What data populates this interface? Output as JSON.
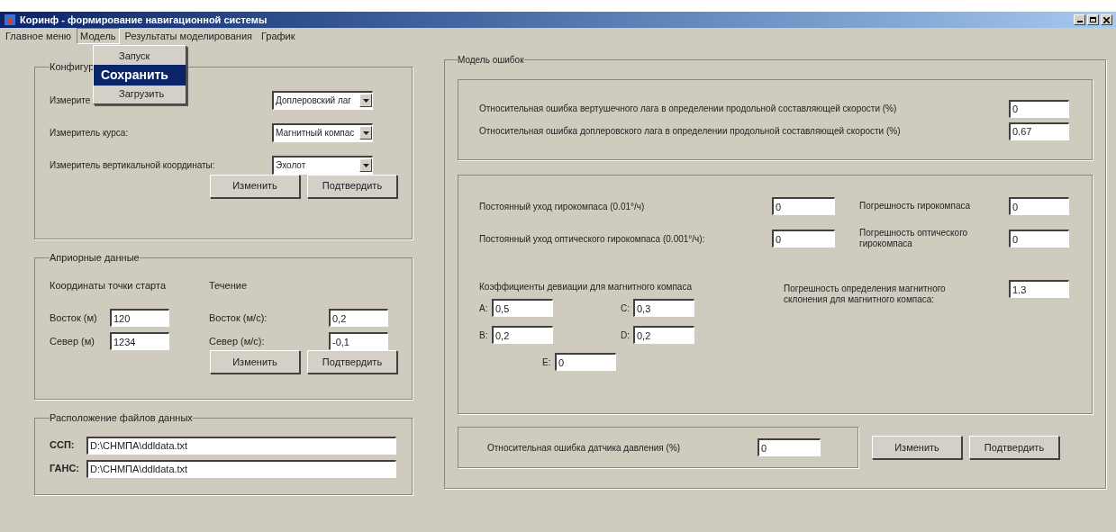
{
  "window": {
    "title": "Коринф - формирование навигационной системы"
  },
  "menu_bar": [
    {
      "label": "Главное меню",
      "selected": false
    },
    {
      "label": "Модель",
      "selected": true
    },
    {
      "label": "Результаты моделирования",
      "selected": false
    },
    {
      "label": "График",
      "selected": false
    }
  ],
  "dropdown_menu": [
    {
      "label": "Запуск",
      "selected": false
    },
    {
      "label": "Сохранить",
      "selected": true
    },
    {
      "label": "Загрузить",
      "selected": false
    }
  ],
  "configuration": {
    "title": "Конфигур",
    "rows": [
      {
        "label": "Измерите",
        "value": "Доплеровский лаг"
      },
      {
        "label": "Измеритель курса:",
        "value": "Магнитный компас"
      },
      {
        "label": "Измеритель вертикальной координаты:",
        "value": "Эхолот"
      }
    ],
    "buttons": [
      "Изменить",
      "Подтвердить"
    ]
  },
  "a_priori": {
    "title": "Априорные данные",
    "start_heading": "Координаты точки старта",
    "current_heading": "Течение",
    "start_fields": [
      {
        "label": "Восток (м)",
        "value": "120"
      },
      {
        "label": "Север (м)",
        "value": "1234"
      }
    ],
    "current_fields": [
      {
        "label": "Восток (м/с):",
        "value": "0,2"
      },
      {
        "label": "Север (м/с):",
        "value": "-0,1"
      }
    ],
    "buttons": [
      "Изменить",
      "Подтвердить"
    ]
  },
  "data_files": {
    "title": "Расположение файлов данных",
    "fields": [
      {
        "label": "ССП:",
        "value": "D:\\CHMПA\\ddldata.txt"
      },
      {
        "label": "ГАНС:",
        "value": "D:\\CHMПA\\ddldata.txt"
      }
    ]
  },
  "error_model": {
    "title": "Модель ошибок",
    "speed_errors": [
      {
        "label": "Относительная ошибка вертушечного лага в определении продольной составляющей скорости (%)",
        "value": "0"
      },
      {
        "label": "Относительная ошибка доплеровского лага в определении продольной составляющей скорости (%)",
        "value": "0.67"
      }
    ],
    "gyro_drift": [
      {
        "label": "Постоянный уход гирокомпаса (0.01°/ч)",
        "value": "0"
      },
      {
        "label": "Постоянный уход оптического гирокомпаса (0.001°/ч):",
        "value": "0"
      }
    ],
    "gyro_errors": [
      {
        "label": "Погрешность гирокомпаса",
        "value": "0"
      },
      {
        "label": "Погрешность оптического гирокомпаса",
        "value": "0"
      }
    ],
    "deviation": {
      "heading": "Коэффициенты девиации для магнитного компаса",
      "coefficients": [
        {
          "label": "A:",
          "value": "0,5"
        },
        {
          "label": "C:",
          "value": "0,3"
        },
        {
          "label": "B:",
          "value": "0,2"
        },
        {
          "label": "D:",
          "value": "0,2"
        },
        {
          "label": "E:",
          "value": "0"
        }
      ]
    },
    "declination": {
      "label": "Погрешность определения магнитного склонения для магнитного компаса:",
      "value": "1.3"
    },
    "pressure": {
      "label": "Относительная ошибка датчика давления (%)",
      "value": "0"
    },
    "buttons": [
      "Изменить",
      "Подтвердить"
    ]
  }
}
